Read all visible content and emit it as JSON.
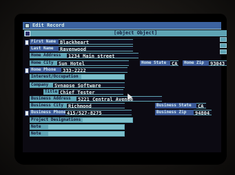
{
  "window": {
    "title": "Edit Record"
  },
  "form": {
    "title": {
      "label": "Title",
      "value": "Chief Tester"
    },
    "first_name": {
      "label": "First Name",
      "value": "Blackheart"
    },
    "last_name": {
      "label": "Last Name",
      "value": "Ravenwood"
    },
    "home_address": {
      "label": "Home Address",
      "value": "1234 Main street"
    },
    "home_city": {
      "label": "Home City",
      "value": "Sun Hotel"
    },
    "home_state": {
      "label": "Home State",
      "value": "CA"
    },
    "home_zip": {
      "label": "Home Zip",
      "value": "93043"
    },
    "home_phone": {
      "label": "Home Phone",
      "value": "333-2222"
    },
    "interest_occupation": {
      "label": "Interest/Occupation",
      "value": ""
    },
    "company": {
      "label": "Company",
      "value": "Synapse Software"
    },
    "business_address": {
      "label": "Business Address",
      "value": "5221 Central Avenue"
    },
    "business_city": {
      "label": "Business City",
      "value": "Richmond"
    },
    "business_state": {
      "label": "Business State",
      "value": "CA"
    },
    "business_phone": {
      "label": "Business Phone",
      "value": "415/527-8275"
    },
    "business_zip": {
      "label": "Business Zip",
      "value": "94804"
    },
    "project_designations": {
      "label": "Project Designations",
      "value": ""
    },
    "note1": {
      "label": "Note",
      "value": ""
    },
    "note2": {
      "label": "Note",
      "value": ""
    }
  },
  "colors": {
    "accent": "#5fa4b4",
    "title_bar": "#3c63a0",
    "field_bg": "#101020"
  }
}
